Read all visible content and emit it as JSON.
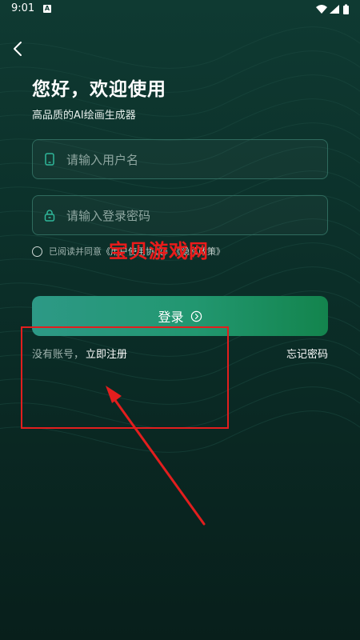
{
  "status": {
    "time": "9:01",
    "notification_letter": "A"
  },
  "header": {
    "title": "您好，欢迎使用",
    "subtitle": "高品质的AI绘画生成器"
  },
  "form": {
    "username_placeholder": "请输入用户名",
    "password_placeholder": "请输入登录密码",
    "agreement_prefix": "已阅读并同意",
    "user_agreement": "《用户使用协议》",
    "privacy_policy": "《隐私政策》",
    "login_label": "登录"
  },
  "footer": {
    "no_account": "没有账号，",
    "register": "立即注册",
    "forgot": "忘记密码"
  },
  "watermark": "宝贝游戏网",
  "colors": {
    "background": "#0b2e28",
    "button_start": "#2d9986",
    "button_end": "#13844d",
    "annotation": "#e21e1e"
  },
  "icons": {
    "back": "chevron-left-icon",
    "username": "phone-icon",
    "password": "lock-icon",
    "login": "circle-arrow-right-icon"
  }
}
